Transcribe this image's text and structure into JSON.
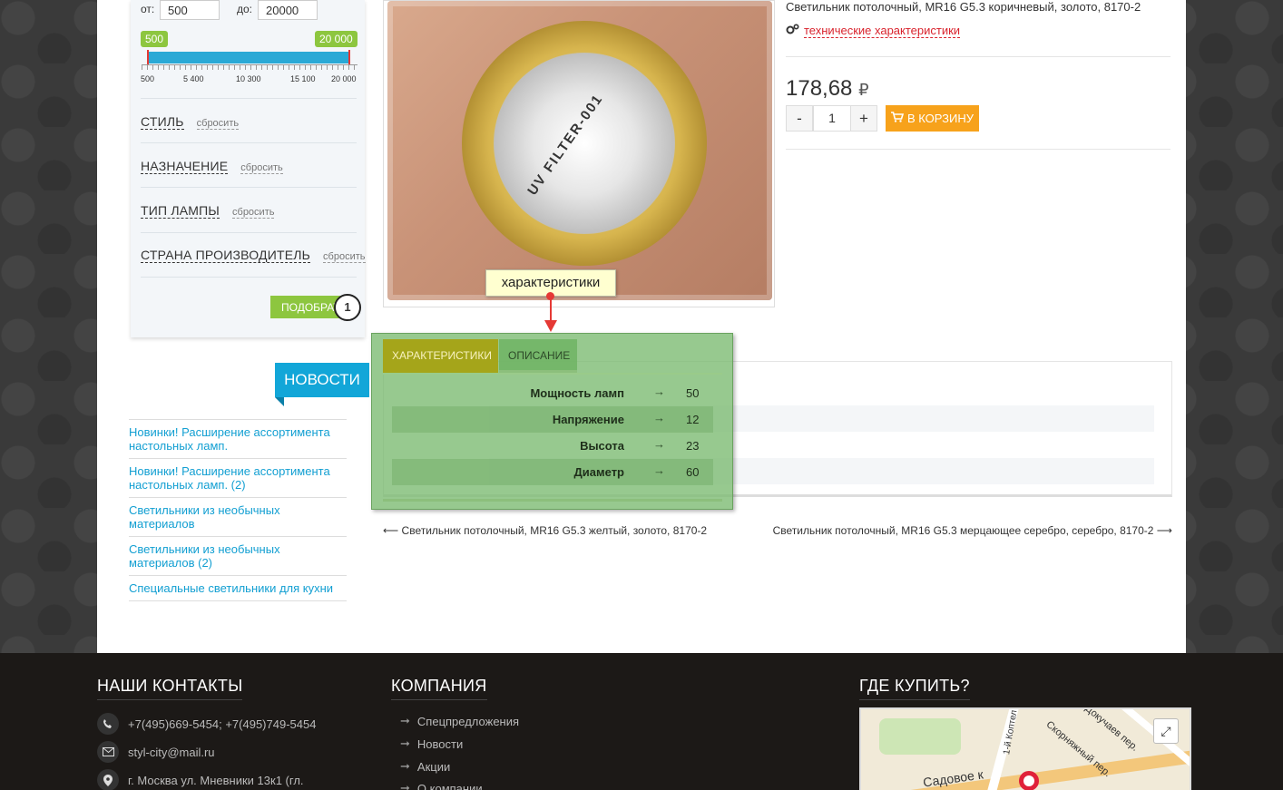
{
  "filter": {
    "from_label": "от:",
    "from_value": "500",
    "to_label": "до:",
    "to_value": "20000",
    "min_badge": "500",
    "max_badge": "20 000",
    "ticks": [
      "500",
      "5 400",
      "10 300",
      "15 100",
      "20 000"
    ],
    "groups": [
      {
        "title": "СТИЛЬ",
        "reset": "сбросить"
      },
      {
        "title": "НАЗНАЧЕНИЕ",
        "reset": "сбросить"
      },
      {
        "title": "ТИП ЛАМПЫ",
        "reset": "сбросить"
      },
      {
        "title": "СТРАНА ПРОИЗВОДИТЕЛЬ",
        "reset": "сбросить"
      }
    ],
    "pick_button": "ПОДОБРАТЬ",
    "step_number": "1"
  },
  "news": {
    "header": "НОВОСТИ",
    "items": [
      "Новинки! Расширение ассортимента настольных ламп.",
      "Новинки! Расширение ассортимента настольных ламп. (2)",
      "Светильники из необычных материалов",
      "Светильники из необычных материалов (2)",
      "Специальные светильники для кухни"
    ]
  },
  "product": {
    "title": "Светильник потолочный, MR16 G5.3 коричневый, золото, 8170-2",
    "tech_link": "технические характеристики",
    "image_text": "UV FILTER-001",
    "price": "178,68",
    "currency": "₽",
    "qty_minus": "-",
    "qty_value": "1",
    "qty_plus": "+",
    "cart_button": "В КОРЗИНУ"
  },
  "tooltip": {
    "text": "характеристики"
  },
  "tabs": {
    "active": "ХАРАКТЕРИСТИКИ",
    "inactive": "ОПИСАНИЕ"
  },
  "specs": [
    {
      "name": "Мощность ламп",
      "arrow": "→",
      "value": "50"
    },
    {
      "name": "Напряжение",
      "arrow": "→",
      "value": "12"
    },
    {
      "name": "Высота",
      "arrow": "→",
      "value": "23"
    },
    {
      "name": "Диаметр",
      "arrow": "→",
      "value": "60"
    }
  ],
  "nav": {
    "prev": "Светильник потолочный, MR16 G5.3 желтый, золото, 8170-2",
    "next": "Светильник потолочный, MR16 G5.3 мерцающее серебро, серебро, 8170-2"
  },
  "footer": {
    "contacts_title": "НАШИ КОНТАКТЫ",
    "phone": "+7(495)669-5454; +7(495)749-5454",
    "email": "styl-city@mail.ru",
    "address": "г. Москва ул. Мневники 13к1 (гл.",
    "company_title": "КОМПАНИЯ",
    "company_links": [
      "Спецпредложения",
      "Новости",
      "Акции",
      "О компании"
    ],
    "where_title": "ГДЕ КУПИТЬ?",
    "map_labels": [
      "Садовое к",
      "1-й Коптел",
      "Скорняжный пер.",
      "Докучаев пер."
    ]
  },
  "colors": {
    "accent_blue": "#12a6d8",
    "filter_green": "#8dc63f",
    "cart_orange": "#f7a21b",
    "link_red": "#d9232d",
    "highlight_green": "#7aba70"
  }
}
